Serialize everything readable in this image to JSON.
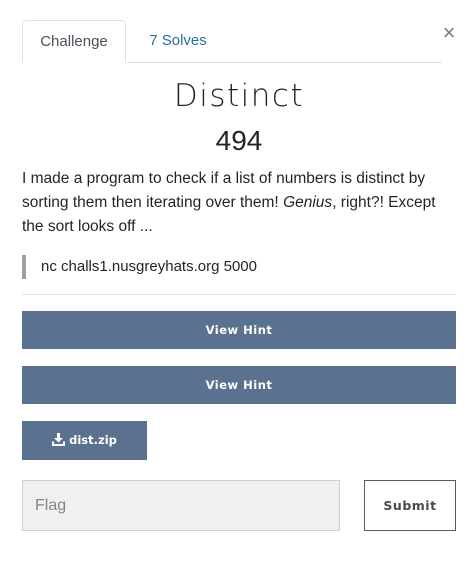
{
  "tabs": [
    {
      "label": "Challenge",
      "active": true
    },
    {
      "label": "7 Solves",
      "active": false
    }
  ],
  "close_icon": "×",
  "challenge": {
    "name": "Distinct",
    "value": "494",
    "description": {
      "part1": "I made a program to check if a list of numbers is distinct by sorting them then iterating over them! ",
      "emphasis": "Genius",
      "part2": ", right?! Except the sort looks off ..."
    },
    "connection_info": "nc challs1.nusgreyhats.org 5000"
  },
  "hints": [
    {
      "label": "View Hint"
    },
    {
      "label": "View Hint"
    }
  ],
  "files": [
    {
      "label": "dist.zip",
      "icon": "download-icon"
    }
  ],
  "flag_form": {
    "placeholder": "Flag",
    "submit_label": "Submit"
  },
  "colors": {
    "button_bg": "#5b7190",
    "tab_link": "#2b6f9c"
  }
}
